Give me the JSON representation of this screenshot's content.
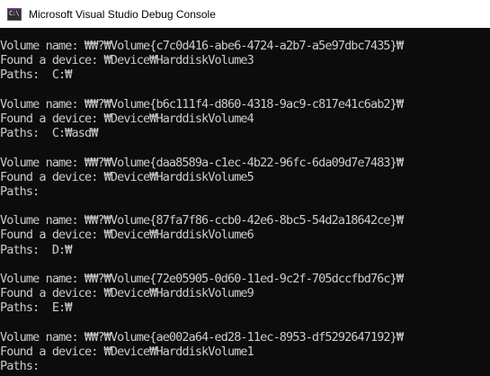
{
  "window": {
    "title": "Microsoft Visual Studio Debug Console",
    "icon": "vs-console-icon",
    "icon_glyph": "C:\\"
  },
  "console": {
    "blocks": [
      {
        "volume": "Volume name: ₩₩?₩Volume{c7c0d416-abe6-4724-a2b7-a5e97dbc7435}₩",
        "device": "Found a device: ₩Device₩HarddiskVolume3",
        "paths": "Paths:  C:₩"
      },
      {
        "volume": "Volume name: ₩₩?₩Volume{b6c111f4-d860-4318-9ac9-c817e41c6ab2}₩",
        "device": "Found a device: ₩Device₩HarddiskVolume4",
        "paths": "Paths:  C:₩asd₩"
      },
      {
        "volume": "Volume name: ₩₩?₩Volume{daa8589a-c1ec-4b22-96fc-6da09d7e7483}₩",
        "device": "Found a device: ₩Device₩HarddiskVolume5",
        "paths": "Paths:"
      },
      {
        "volume": "Volume name: ₩₩?₩Volume{87fa7f86-ccb0-42e6-8bc5-54d2a18642ce}₩",
        "device": "Found a device: ₩Device₩HarddiskVolume6",
        "paths": "Paths:  D:₩"
      },
      {
        "volume": "Volume name: ₩₩?₩Volume{72e05905-0d60-11ed-9c2f-705dccfbd76c}₩",
        "device": "Found a device: ₩Device₩HarddiskVolume9",
        "paths": "Paths:  E:₩"
      },
      {
        "volume": "Volume name: ₩₩?₩Volume{ae002a64-ed28-11ec-8953-df5292647192}₩",
        "device": "Found a device: ₩Device₩HarddiskVolume1",
        "paths": "Paths:"
      }
    ]
  },
  "colors": {
    "console_bg": "#0c0c0c",
    "console_text": "#cccccc",
    "titlebar_bg": "#ffffff"
  }
}
